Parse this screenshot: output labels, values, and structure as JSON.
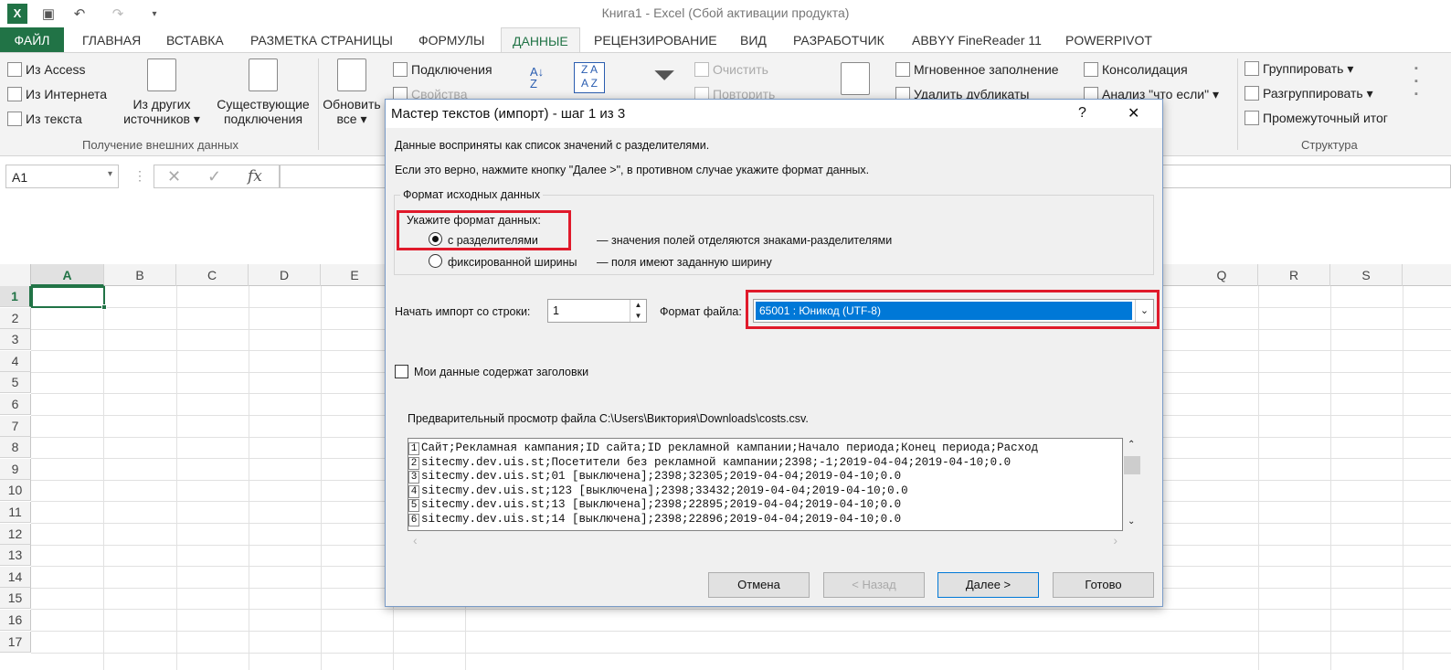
{
  "window": {
    "title": "Книга1 - Excel (Сбой активации продукта)"
  },
  "tabs": [
    "ФАЙЛ",
    "ГЛАВНАЯ",
    "ВСТАВКА",
    "РАЗМЕТКА СТРАНИЦЫ",
    "ФОРМУЛЫ",
    "ДАННЫЕ",
    "РЕЦЕНЗИРОВАНИЕ",
    "ВИД",
    "РАЗРАБОТЧИК",
    "ABBYY FineReader 11",
    "POWERPIVOT"
  ],
  "ribbon": {
    "from_access": "Из Access",
    "from_web": "Из Интернета",
    "from_text": "Из текста",
    "from_other_1": "Из других",
    "from_other_2": "источников",
    "existing_1": "Существующие",
    "existing_2": "подключения",
    "refresh_1": "Обновить",
    "refresh_2": "все",
    "connections": "Подключения",
    "properties": "Свойства",
    "clear": "Очистить",
    "reapply": "Повторить",
    "flash_fill": "Мгновенное заполнение",
    "remove_dup": "Удалить дубликаты",
    "consolidate": "Консолидация",
    "whatif": "Анализ \"что если\"",
    "group": "Группировать",
    "ungroup": "Разгруппировать",
    "subtotal": "Промежуточный итог",
    "group_external": "Получение внешних данных",
    "group_structure": "Структура"
  },
  "namebox": "A1",
  "columns": [
    "A",
    "B",
    "C",
    "D",
    "E",
    "Q",
    "R",
    "S"
  ],
  "rows": [
    "1",
    "2",
    "3",
    "4",
    "5",
    "6",
    "7",
    "8",
    "9",
    "10",
    "11",
    "12",
    "13",
    "14",
    "15",
    "16",
    "17"
  ],
  "dialog": {
    "title": "Мастер текстов (импорт) - шаг 1 из 3",
    "help": "?",
    "close": "✕",
    "line1": "Данные восприняты как список значений с разделителями.",
    "line2": "Если это верно, нажмите кнопку \"Далее >\", в противном случае укажите формат данных.",
    "group_label": "Формат исходных данных",
    "specify": "Укажите формат данных:",
    "opt_delim": "с разделителями",
    "opt_delim_desc": "— значения полей отделяются знаками-разделителями",
    "opt_fixed": "фиксированной ширины",
    "opt_fixed_desc": "— поля имеют заданную ширину",
    "start_row_label": "Начать импорт со строки:",
    "start_row": "1",
    "file_format_label": "Формат файла:",
    "file_format": "65001 : Юникод (UTF-8)",
    "headers_label": "Мои данные содержат заголовки",
    "preview_label": "Предварительный просмотр файла C:\\Users\\Виктория\\Downloads\\costs.csv.",
    "preview": [
      {
        "n": "1",
        "text": "Сайт;Рекламная кампания;ID сайта;ID рекламной кампании;Начало периода;Конец периода;Расход"
      },
      {
        "n": "2",
        "text": "sitecmy.dev.uis.st;Посетители без рекламной кампании;2398;-1;2019-04-04;2019-04-10;0.0"
      },
      {
        "n": "3",
        "text": "sitecmy.dev.uis.st;01 [выключена];2398;32305;2019-04-04;2019-04-10;0.0"
      },
      {
        "n": "4",
        "text": "sitecmy.dev.uis.st;123 [выключена];2398;33432;2019-04-04;2019-04-10;0.0"
      },
      {
        "n": "5",
        "text": "sitecmy.dev.uis.st;13 [выключена];2398;22895;2019-04-04;2019-04-10;0.0"
      },
      {
        "n": "6",
        "text": "sitecmy.dev.uis.st;14 [выключена];2398;22896;2019-04-04;2019-04-10;0.0"
      }
    ],
    "cancel": "Отмена",
    "back": "< Назад",
    "next": "Далее >",
    "finish": "Готово"
  },
  "colors": {
    "excel_green": "#217346",
    "highlight_red": "#e01a2b",
    "select_blue": "#0078d7"
  }
}
